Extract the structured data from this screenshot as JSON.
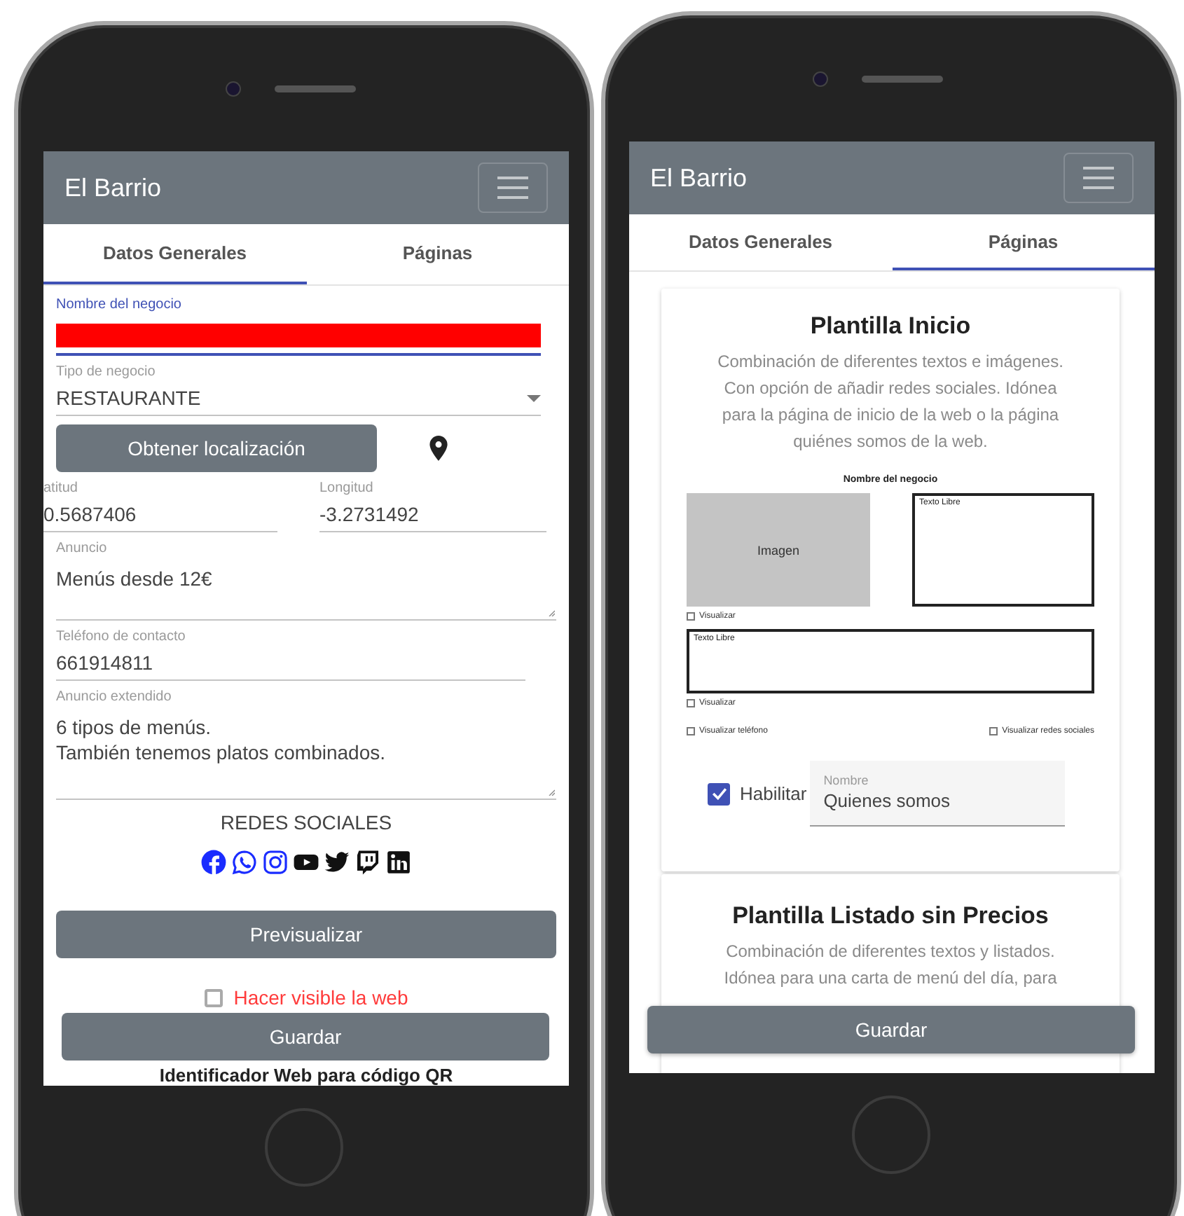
{
  "phones": [
    {
      "kind": "general",
      "app_title": "El Barrio",
      "tabs": [
        {
          "label": "Datos Generales",
          "selected": true
        },
        {
          "label": "Páginas",
          "selected": false
        }
      ],
      "business_name": {
        "label": "Nombre del negocio",
        "focused": true
      },
      "business_type": {
        "label": "Tipo de negocio",
        "value": "RESTAURANTE"
      },
      "location_button": "Obtener localización",
      "latitude": {
        "label": "atitud",
        "value": "0.5687406"
      },
      "longitude": {
        "label": "Longitud",
        "value": "-3.2731492"
      },
      "ad": {
        "label": "Anuncio",
        "value": "Menús desde 12€"
      },
      "contact_phone": {
        "label": "Teléfono de contacto",
        "value": "661914811"
      },
      "extended_ad": {
        "label": "Anuncio extendido",
        "value": "6 tipos de menús.\nTambién tenemos platos combinados."
      },
      "social_heading": "REDES SOCIALES",
      "social_networks": [
        {
          "kind": "facebook",
          "selected": true
        },
        {
          "kind": "whatsapp",
          "selected": true
        },
        {
          "kind": "instagram",
          "selected": true
        },
        {
          "kind": "youtube",
          "selected": false
        },
        {
          "kind": "twitter",
          "selected": false
        },
        {
          "kind": "twitch",
          "selected": false
        },
        {
          "kind": "linkedin",
          "selected": false
        }
      ],
      "preview_button": "Previsualizar",
      "visible_checkbox": {
        "label": "Hacer visible la web",
        "checked": false
      },
      "save_button": "Guardar",
      "qr_heading": "Identificador Web para código QR"
    },
    {
      "kind": "pages",
      "app_title": "El Barrio",
      "tabs": [
        {
          "label": "Datos Generales",
          "selected": false
        },
        {
          "label": "Páginas",
          "selected": true
        }
      ],
      "templates": [
        {
          "title": "Plantilla Inicio",
          "description": "Combinación de diferentes textos e imágenes. Con opción de añadir redes sociales. Idónea para la página de inicio de la web o la página quiénes somos de la web.",
          "preview": {
            "heading": "Nombre del negocio",
            "blocks": [
              {
                "kind": "image",
                "label": "Imagen",
                "option": {
                  "label": "Visualizar",
                  "checked": false
                }
              },
              {
                "kind": "text",
                "label": "Texto Libre"
              },
              {
                "kind": "text",
                "label": "Texto Libre",
                "option": {
                  "label": "Visualizar",
                  "checked": false
                }
              }
            ],
            "options": [
              {
                "label": "Visualizar teléfono",
                "checked": false
              },
              {
                "label": "Visualizar redes sociales",
                "checked": false
              }
            ]
          },
          "enable_checkbox": {
            "label": "Habilitar",
            "checked": true
          },
          "name_field": {
            "label": "Nombre",
            "value": "Quienes somos"
          }
        },
        {
          "title": "Plantilla Listado sin Precios",
          "description": "Combinación de diferentes textos y listados. Idónea para una carta de menú del día, para"
        }
      ],
      "save_button": "Guardar"
    }
  ]
}
